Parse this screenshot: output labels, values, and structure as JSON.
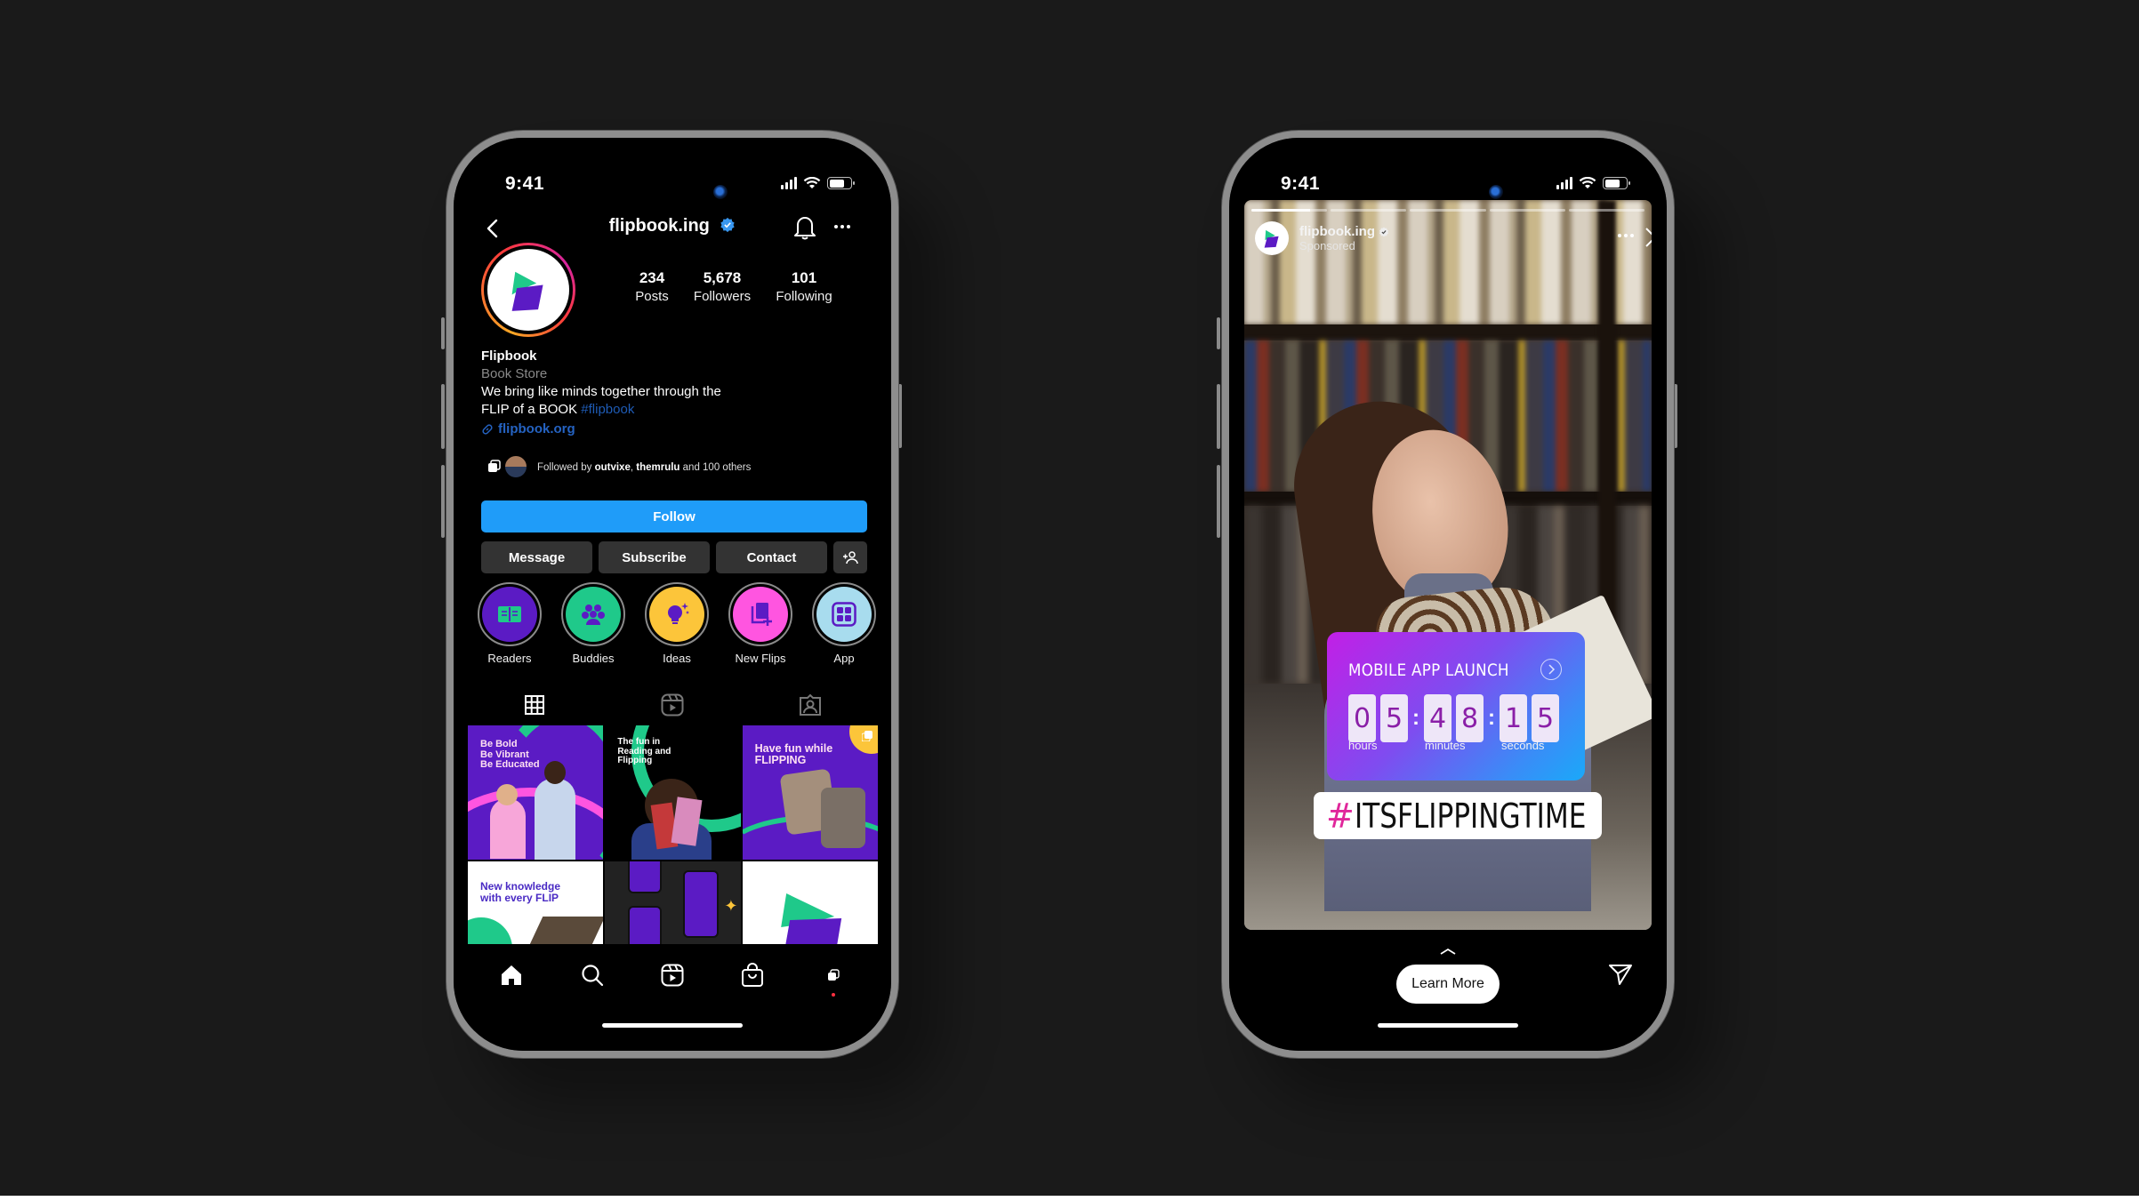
{
  "profile_phone": {
    "status_bar": {
      "time": "9:41"
    },
    "header": {
      "username": "flipbook.ing",
      "verified": true
    },
    "stats": [
      {
        "value": "234",
        "label": "Posts"
      },
      {
        "value": "5,678",
        "label": "Followers"
      },
      {
        "value": "101",
        "label": "Following"
      }
    ],
    "bio": {
      "name": "Flipbook",
      "category": "Book Store",
      "line1": "We bring like minds together through the",
      "line2": "FLIP of a BOOK",
      "hashtag": "#flipbook",
      "link": "flipbook.org"
    },
    "followed_by": {
      "prefix": "Followed by",
      "user1": "outvixe",
      "separator": ",",
      "user2": "themrulu",
      "suffix": "and 100 others"
    },
    "buttons": {
      "follow": "Follow",
      "message": "Message",
      "subscribe": "Subscribe",
      "contact": "Contact"
    },
    "highlights": [
      {
        "label": "Readers",
        "icon": "open-book-icon",
        "bg": "#5b1bc4",
        "fg": "#1fc98a"
      },
      {
        "label": "Buddies",
        "icon": "group-icon",
        "bg": "#1fc98a",
        "fg": "#5b1bc4"
      },
      {
        "label": "Ideas",
        "icon": "lightbulb-icon",
        "bg": "#fcc53a",
        "fg": "#5b1bc4"
      },
      {
        "label": "New Flips",
        "icon": "add-book-icon",
        "bg": "#ff55e0",
        "fg": "#5b1bc4"
      },
      {
        "label": "App",
        "icon": "app-grid-icon",
        "bg": "#a8dcee",
        "fg": "#5b1bc4"
      }
    ],
    "grid_posts": [
      {
        "text": "Be Bold\nBe Vibrant\nBe Educated"
      },
      {
        "text": "The fun in\nReading and\nFlipping"
      },
      {
        "text": "Have fun while\nFLIPPING"
      },
      {
        "text": "New knowledge\nwith every FLIP"
      },
      {
        "text": ""
      },
      {
        "text": ""
      }
    ],
    "colors": {
      "brand_purple": "#5b1bc4",
      "brand_green": "#1fc98a",
      "follow_blue": "#1f9cf9"
    }
  },
  "story_phone": {
    "status_bar": {
      "time": "9:41"
    },
    "progress": {
      "segments": 5,
      "current_index": 0,
      "current_fraction": 0.78
    },
    "header": {
      "username": "flipbook.ing",
      "verified": true,
      "subtitle": "Sponsored"
    },
    "countdown": {
      "title": "MOBILE APP LAUNCH",
      "hours": [
        "0",
        "5"
      ],
      "minutes": [
        "4",
        "8"
      ],
      "seconds": [
        "1",
        "5"
      ],
      "labels": {
        "hours": "hours",
        "minutes": "minutes",
        "seconds": "seconds"
      }
    },
    "hashtag_sticker": {
      "hash": "#",
      "word": "ITSFLIPPINGTIME"
    },
    "cta": "Learn More"
  }
}
